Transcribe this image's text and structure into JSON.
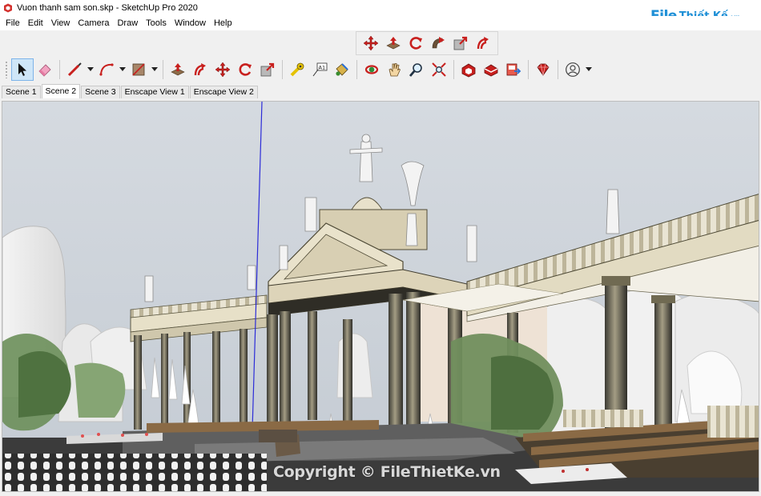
{
  "window": {
    "title": "Vuon thanh sam son.skp - SketchUp Pro 2020"
  },
  "logo": {
    "file": "File",
    "rest": "Thiết Kế",
    "suffix": ".vn"
  },
  "menu": [
    "File",
    "Edit",
    "View",
    "Camera",
    "Draw",
    "Tools",
    "Window",
    "Help"
  ],
  "toolbar_top": {
    "icons": [
      "move-icon",
      "push-pull-icon",
      "rotate-icon",
      "follow-me-icon",
      "scale-icon",
      "offset-icon"
    ]
  },
  "toolbar_main": {
    "icons": [
      "select-icon",
      "eraser-icon",
      "line-icon",
      "arc-icon",
      "rectangle-icon",
      "push-pull-icon",
      "offset-icon",
      "move-icon",
      "rotate-icon",
      "scale-icon",
      "tape-measure-icon",
      "text-icon",
      "paint-bucket-icon",
      "orbit-icon",
      "pan-icon",
      "zoom-icon",
      "zoom-extents-icon",
      "warehouse-icon",
      "extension-icon",
      "send-layout-icon",
      "ruby-icon",
      "account-icon"
    ]
  },
  "scenes": [
    {
      "label": "Scene 1",
      "selected": false
    },
    {
      "label": "Scene 2",
      "selected": true
    },
    {
      "label": "Scene 3",
      "selected": false
    },
    {
      "label": "Enscape View 1",
      "selected": false
    },
    {
      "label": "Enscape View 2",
      "selected": false
    }
  ],
  "viewport": {
    "watermark": "Copyright © FileThietKe.vn"
  },
  "colors": {
    "accent": "#1e8fd6",
    "icon_red": "#c8201e",
    "colonnade": "#d8cfb4",
    "sky": "#cdd3da"
  }
}
